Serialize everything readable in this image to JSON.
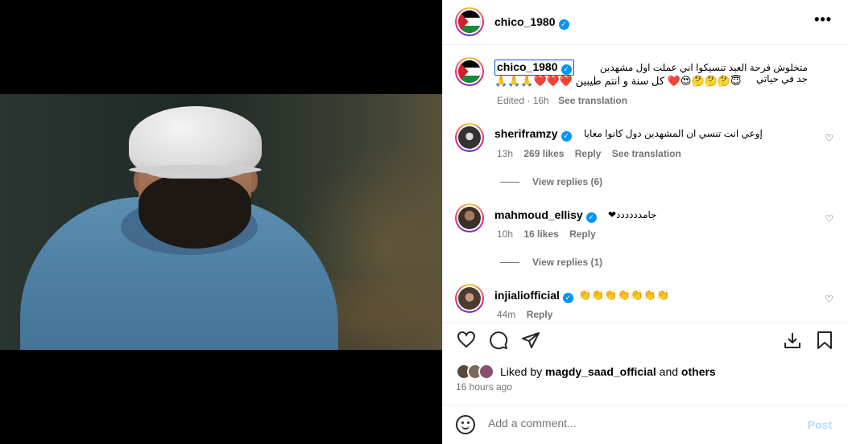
{
  "post": {
    "username": "chico_1980",
    "caption_line1": "متخلوش فرحة العيد تنسيكوا اني عملت اول مشهدين جد في حياتي",
    "caption_line2": "🙏🙏🙏❤️❤️❤️ كل سنة و انتم طيبين ❤️😍🤔🤔🤔😇",
    "caption_meta_edited": "Edited · 16h",
    "see_translation": "See translation"
  },
  "comments": [
    {
      "username": "sheriframzy",
      "text": "إوعي انت تنسي ان المشهدين دول كانوا معايا",
      "time": "13h",
      "likes": "269 likes",
      "reply": "Reply",
      "see_translation": "See translation",
      "view_replies": "View replies (6)"
    },
    {
      "username": "mahmoud_ellisy",
      "text": "جامدددددد❤",
      "time": "10h",
      "likes": "16 likes",
      "reply": "Reply",
      "view_replies": "View replies (1)"
    },
    {
      "username": "injialiofficial",
      "text": "👏👏👏👏👏👏👏",
      "time": "44m",
      "reply": "Reply"
    }
  ],
  "liked_by": {
    "prefix": "Liked by",
    "user": "magdy_saad_official",
    "and": "and",
    "others": "others"
  },
  "timestamp": "16 hours ago",
  "composer": {
    "placeholder": "Add a comment...",
    "post_label": "Post"
  },
  "icons": {
    "more": "•••",
    "like": "♡",
    "comment": "◯",
    "share": "➤",
    "save": "bookmark-icon",
    "download": "download-icon"
  },
  "colors": {
    "verified": "#0095f6",
    "post_disabled": "#b3dbff",
    "muted": "#737373"
  }
}
